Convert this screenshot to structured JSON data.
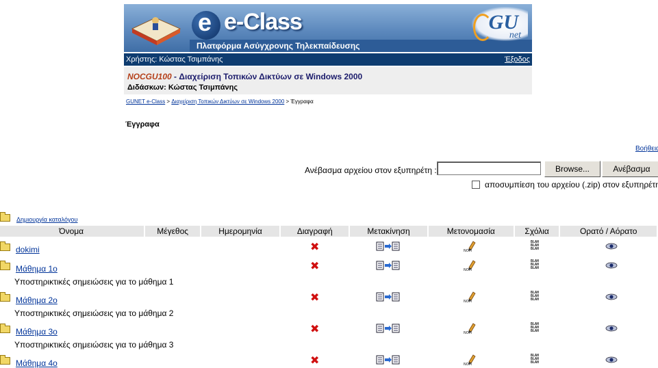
{
  "banner": {
    "title": "e-Class",
    "subtitle": "Πλατφόρμα Ασύγχρονης Τηλεκπαίδευσης",
    "partner_logo": "GU",
    "partner_logo_sub": "net"
  },
  "user_bar": {
    "user_text": "Χρήστης: Κώστας Τσιμπάνης",
    "logout_label": "Έξοδος"
  },
  "course": {
    "code": "NOCGU100",
    "separator": " - ",
    "title": "Διαχείριση Τοπικών Δικτύων σε Windows 2000",
    "teacher": "Διδάσκων: Κώστας Τσιμπάνης"
  },
  "breadcrumb": {
    "home": "GUNET e-Class",
    "course": "Διαχείριση Τοπικών Δικτύων σε Windows 2000",
    "sep": " > ",
    "current": "Έγγραφα"
  },
  "page_title": "Έγγραφα",
  "help_label": "Βοήθεια",
  "upload": {
    "label": "Ανέβασμα αρχείου στον εξυπηρέτη :",
    "value": "",
    "browse_label": "Browse...",
    "upload_label": "Ανέβασμα",
    "unzip_label": "αποσυμπίεση του αρχείου (.zip) στον εξυπηρέτη"
  },
  "create_dir_label": "Δημιουργία καταλόγου",
  "table": {
    "headers": [
      "Όνομα",
      "Μέγεθος",
      "Ημερομηνία",
      "Διαγραφή",
      "Μετακίνηση",
      "Μετονομασία",
      "Σχόλια",
      "Ορατό / Αόρατο"
    ],
    "rows": [
      {
        "name": "dokimi",
        "desc": ""
      },
      {
        "name": "Μάθημα 1ο",
        "desc": "Υποστηρικτικές σημειώσεις για το μάθημα 1"
      },
      {
        "name": "Μάθημα 2ο",
        "desc": "Υποστηρικτικές σημειώσεις για το μάθημα 2"
      },
      {
        "name": "Μάθημα 3ο",
        "desc": "Υποστηρικτικές σημειώσεις για το μάθημα 3"
      },
      {
        "name": "Μάθημα 4ο",
        "desc": ""
      }
    ]
  },
  "icons": {
    "delete": "delete-x-icon",
    "move": "move-document-icon",
    "rename": "rename-pencil-icon",
    "comment": "comment-blah-icon",
    "visibility": "eye-icon",
    "folder": "folder-icon"
  },
  "colors": {
    "user_bar": "#0e3c70",
    "course_code": "#b5401a",
    "link": "#003399",
    "header_bg": "#e5e5e5"
  }
}
